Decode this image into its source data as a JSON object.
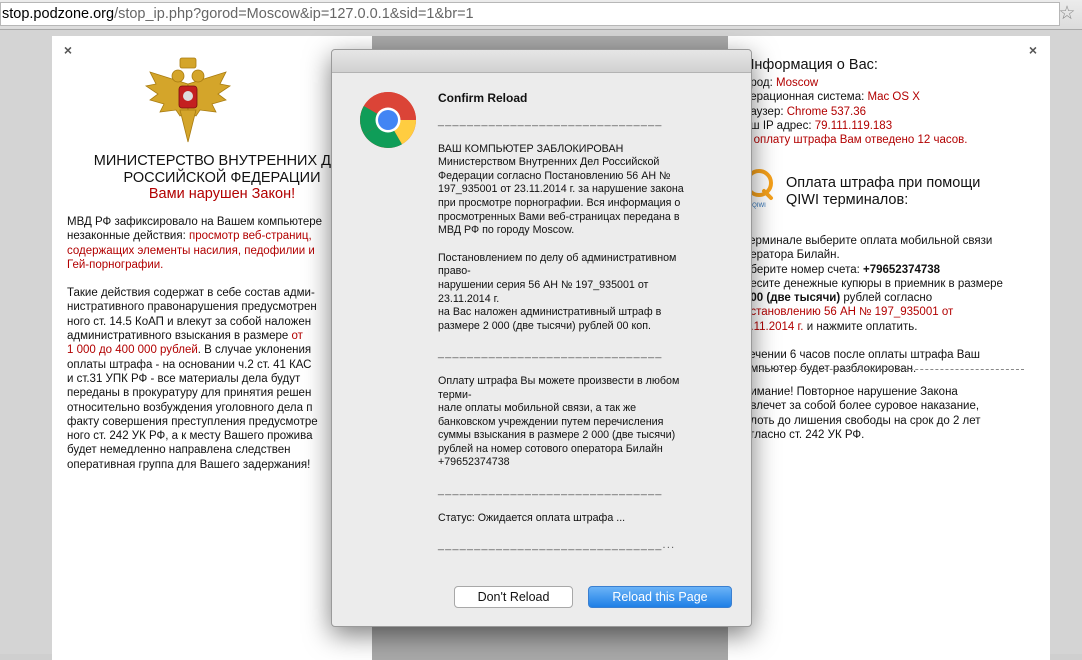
{
  "browser": {
    "url_host": "stop.podzone.org",
    "url_path": "/stop_ip.php?gorod=Moscow&ip=127.0.0.1&sid=1&br=1"
  },
  "left_panel": {
    "close": "×",
    "title_line1": "МИНИСТЕРСТВО ВНУТРЕННИХ ДЕЛ",
    "title_line2": "РОССИЙСКОЙ ФЕДЕРАЦИИ",
    "subtitle": "Вами нарушен Закон!",
    "p1_lines": [
      {
        "text": "МВД РФ зафиксировало на Вашем компьютере",
        "red": ""
      },
      {
        "text": "незаконные действия: ",
        "red": "просмотр веб-страниц,"
      },
      {
        "text": "",
        "red": "содержащих элементы насилия, педофилии и"
      },
      {
        "text": "",
        "red": "Гей-порнографии."
      }
    ],
    "p2_lines": [
      {
        "text": "Такие действия содержат в себе состав адми-",
        "red": ""
      },
      {
        "text": "нистративного правонарушения предусмотрен",
        "red": ""
      },
      {
        "text": "ного ст. 14.5 КоАП и влекут за собой наложен",
        "red": ""
      },
      {
        "text": "административного взыскания в размере ",
        "red": "от"
      },
      {
        "text": "",
        "red": "1 000 до 400 000 рублей",
        "after": ". В случае уклонения"
      },
      {
        "text": "оплаты штрафа - на основании ч.2 ст. 41 КАС",
        "red": ""
      },
      {
        "text": "и ст.31 УПК РФ - все материалы дела будут",
        "red": ""
      },
      {
        "text": "переданы в прокуратуру для принятия решен",
        "red": ""
      },
      {
        "text": "относительно возбуждения уголовного дела п",
        "red": ""
      },
      {
        "text": "факту совершения преступления предусмотре",
        "red": ""
      },
      {
        "text": "ного ст. 242 УК РФ, а к месту Вашего прожива",
        "red": ""
      },
      {
        "text": "будет немедленно направлена следствен",
        "red": ""
      },
      {
        "text": "оперативная группа для Вашего задержания!",
        "red": ""
      }
    ]
  },
  "right_panel": {
    "close": "×",
    "info_title": "Информация о Вас:",
    "info": [
      {
        "label": "ород: ",
        "value": "Moscow"
      },
      {
        "label": "перационная система: ",
        "value": "Mac OS X"
      },
      {
        "label": "раузер: ",
        "value": "Chrome 537.36"
      },
      {
        "label": "аш IP адрес: ",
        "value": "79.111.119.183"
      },
      {
        "label": "",
        "value": "а оплату штрафа Вам отведено 12 часов."
      }
    ],
    "qiwi_title_line1": "Оплата штрафа при помощи",
    "qiwi_title_line2": "QIWI терминалов:",
    "qiwi_logo_text": "QIWI",
    "steps": [
      {
        "parts": [
          {
            "t": "терминале выберите оплата мобильной связи",
            "c": ""
          }
        ]
      },
      {
        "parts": [
          {
            "t": "ператора Билайн.",
            "c": ""
          }
        ]
      },
      {
        "parts": [
          {
            "t": "аберите номер счета: ",
            "c": ""
          },
          {
            "t": "+79652374738",
            "c": "b"
          }
        ]
      },
      {
        "parts": [
          {
            "t": "несите денежные купюры в приемник в размере",
            "c": ""
          }
        ]
      },
      {
        "parts": [
          {
            "t": " 000 (две тысячи)",
            "c": "b"
          },
          {
            "t": " рублей согласно",
            "c": ""
          }
        ]
      },
      {
        "parts": [
          {
            "t": "остановлению 56 АН № 197_935001 от",
            "c": "r"
          }
        ]
      },
      {
        "parts": [
          {
            "t": "3.11.2014 г.",
            "c": "r"
          },
          {
            "t": " и нажмите оплатить.",
            "c": ""
          }
        ]
      }
    ],
    "unlock_lines": [
      "течении 6 часов после оплаты штрафа Ваш",
      "омпьютер будет разблокирован."
    ],
    "warning_lines": [
      "нимание! Повторное нарушение Закона",
      "овлечет за собой более суровое наказание,",
      "плоть до лишения свободы на срок до 2 лет",
      "огласно ст. 242 УК РФ."
    ]
  },
  "dialog": {
    "title": "Confirm Reload",
    "paragraphs": [
      "_______________________________",
      "ВАШ КОМПЬЮТЕР ЗАБЛОКИРОВАН\nМинистерством Внутренних Дел Российской\nФедерации согласно Постановлению 56 АН №\n197_935001 от 23.11.2014 г. за нарушение закона\nпри просмотре порнографии. Вся информация о\nпросмотренных Вами веб-страницах передана в\nМВД РФ по городу Moscow.",
      "Постановлением по делу об административном\nправо-\nнарушении серия 56 АН № 197_935001 от\n23.11.2014 г.\nна Вас наложен административный штраф в\nразмере 2 000 (две тысячи) рублей 00 коп.",
      "_______________________________",
      "Оплату штрафа Вы можете произвести в любом\nтерми-\nнале оплаты мобильной связи, а так же\nбанковском учреждении путем перечисления\nсуммы взыскания в размере 2 000 (две тысячи)\nрублей на номер сотового оператора Билайн\n+79652374738",
      "_______________________________",
      "Статус: Ожидается оплата штрафа ...",
      "_______________________________..."
    ],
    "dont_reload": "Don't Reload",
    "reload": "Reload this Page"
  }
}
